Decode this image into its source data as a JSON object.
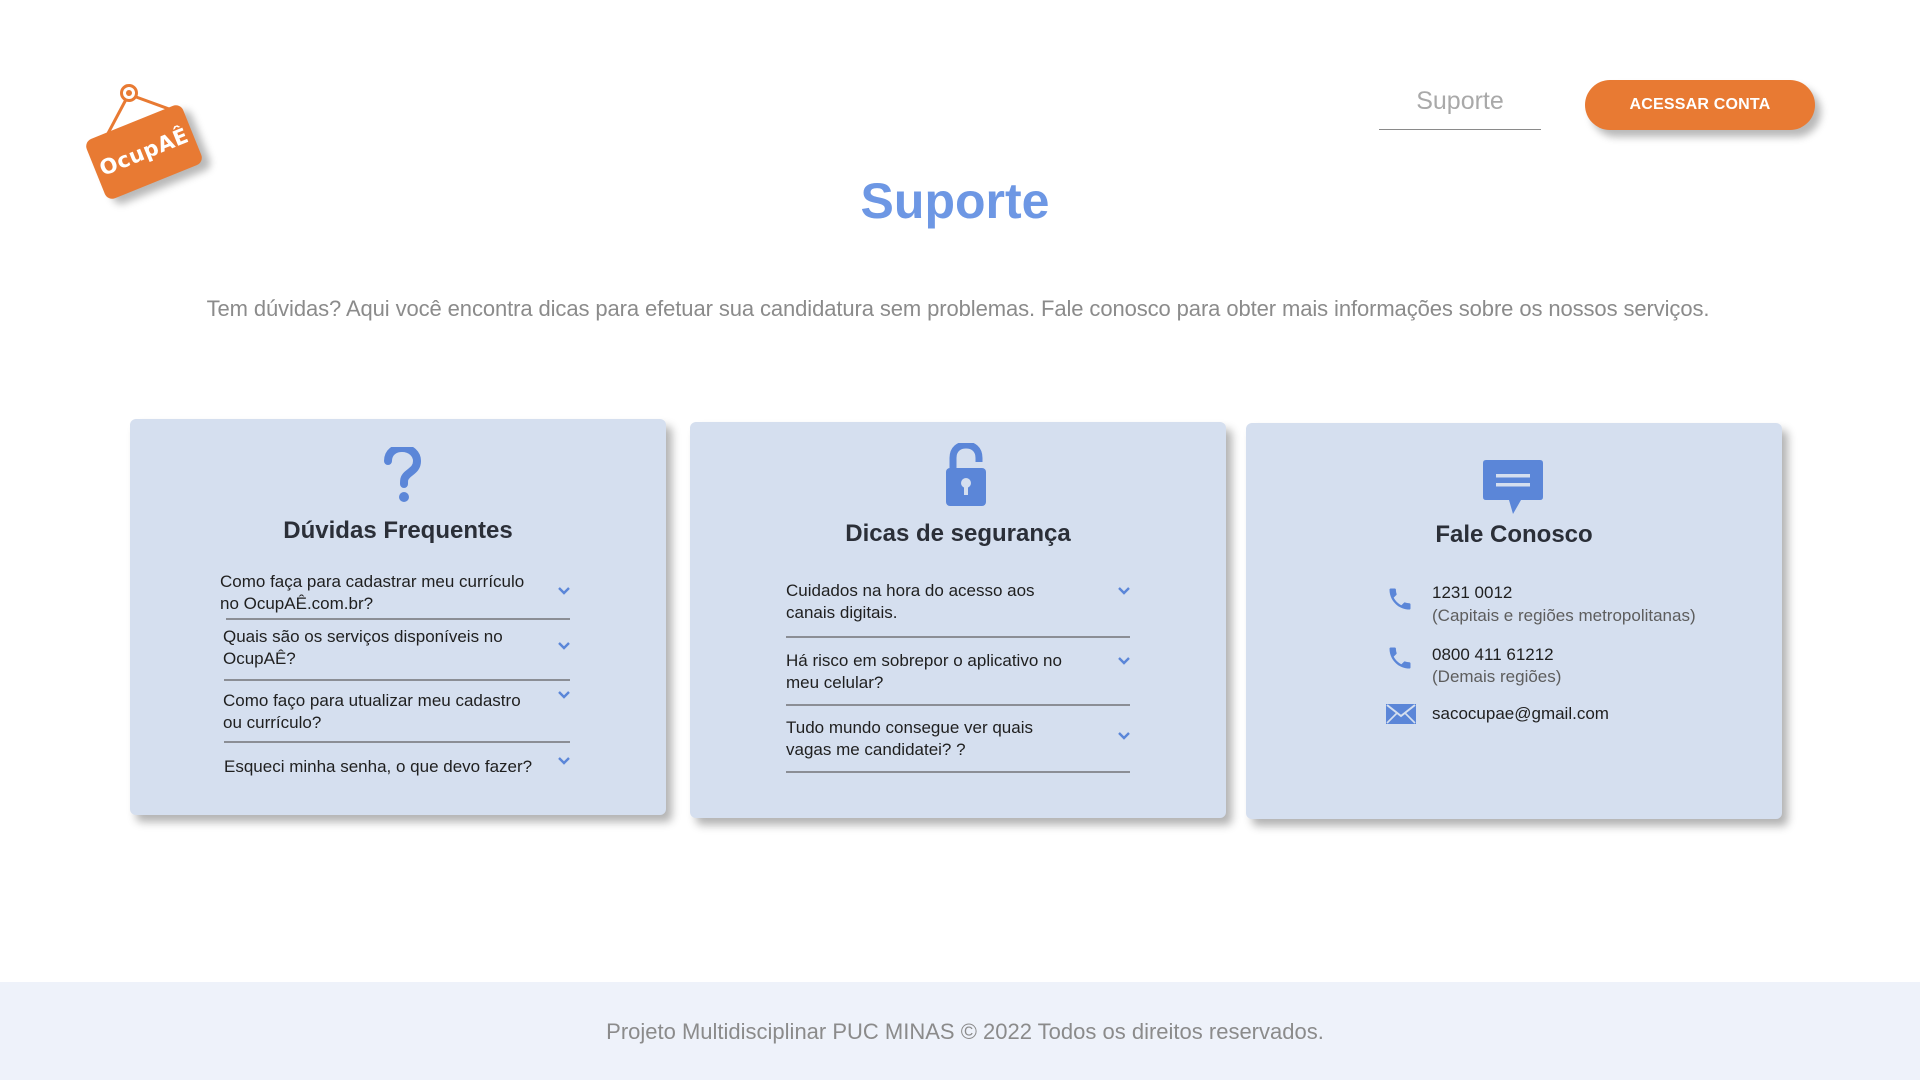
{
  "brand": {
    "name": "OcupAÊ",
    "color": "#e87a33"
  },
  "nav": {
    "link_label": "Suporte",
    "cta_label": "ACESSAR CONTA"
  },
  "hero": {
    "title": "Suporte",
    "subtitle": "Tem dúvidas? Aqui você encontra dicas para efetuar sua candidatura sem problemas. Fale conosco para obter mais informações sobre os nossos serviços."
  },
  "cards": {
    "faq": {
      "icon": "question-mark-icon",
      "title": "Dúvidas Frequentes",
      "items": [
        " Como faça para cadastrar meu currículo\nno OcupAÊ.com.br?",
        "Quais são os serviços disponíveis no\nOcupAÊ?",
        "Como faço para utualizar meu cadastro\nou currículo?",
        "Esqueci minha senha, o que devo fazer?"
      ]
    },
    "security": {
      "icon": "unlocked-padlock-icon",
      "title": "Dicas de segurança",
      "items": [
        "Cuidados na hora  do acesso aos\ncanais digitais.",
        "Há risco em sobrepor o aplicativo no\nmeu celular?",
        "Tudo mundo consegue ver quais\n vagas me candidatei? ?"
      ]
    },
    "contact": {
      "icon": "chat-bubble-icon",
      "title": "Fale Conosco",
      "phone_1": {
        "number": "1231 0012",
        "note": "(Capitais e regiões metropolitanas)"
      },
      "phone_2": {
        "number": "0800 411 61212",
        "note": "(Demais regiões)"
      },
      "email": "sacocupae@gmail.com"
    }
  },
  "footer": {
    "text": "Projeto Multidisciplinar  PUC MINAS © 2022 Todos os direitos reservados."
  },
  "colors": {
    "accent_blue": "#6d97e4",
    "icon_blue": "#5b86d8",
    "card_bg": "#d5dfef",
    "footer_bg": "#eef2fa",
    "orange": "#e87a33"
  }
}
